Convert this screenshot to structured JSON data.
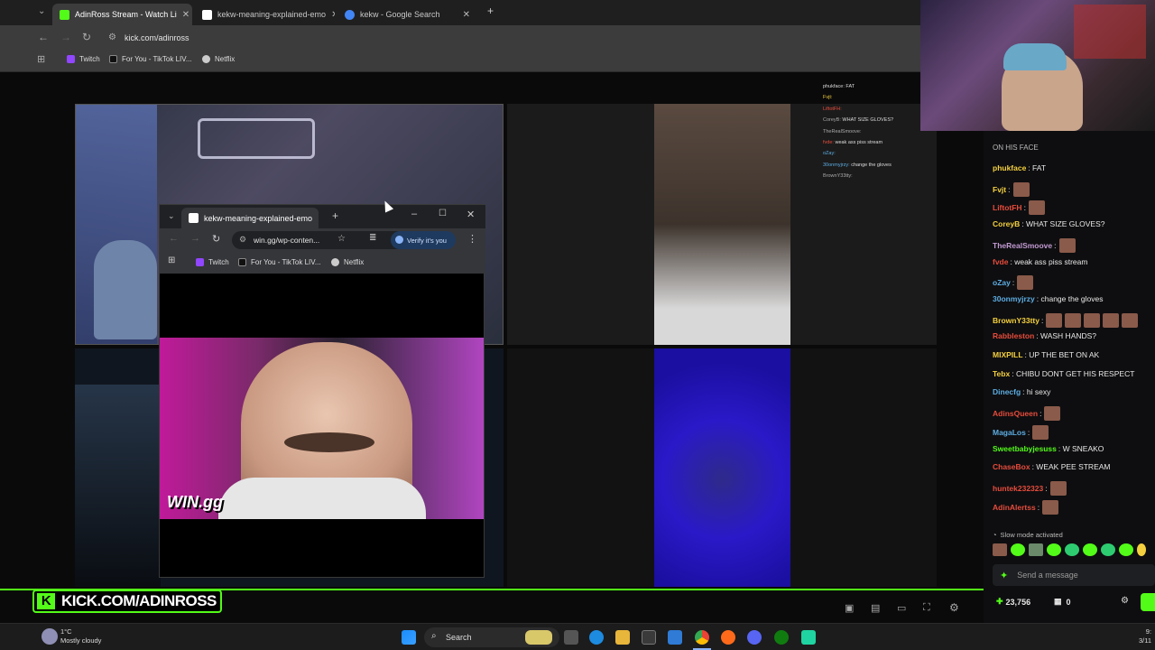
{
  "browser": {
    "tabs": [
      {
        "title": "AdinRoss Stream - Watch Li",
        "active": true,
        "favicon_color": "#53fc18"
      },
      {
        "title": "kekw-meaning-explained-emo",
        "active": false,
        "favicon_color": "#ffffff"
      },
      {
        "title": "kekw - Google Search",
        "active": false,
        "favicon_color": "#4285f4"
      }
    ],
    "new_tab": "+",
    "url": "kick.com/adinross",
    "bookmarks": [
      "Twitch",
      "For You - TikTok LIV...",
      "Netflix"
    ]
  },
  "popup": {
    "tab_title": "kekw-meaning-explained-emo",
    "url": "win.gg/wp-conten...",
    "verify_label": "Verify it's you",
    "bookmarks": [
      "Twitch",
      "For You - TikTok LIV...",
      "Netflix"
    ],
    "watermark": "WIN.gg"
  },
  "overlay_chat": [
    {
      "user": "phukface:",
      "text": "FAT"
    },
    {
      "user": "Fvjt:",
      "text": ""
    },
    {
      "user": "LiftotFH:",
      "text": ""
    },
    {
      "user": "CoreyB:",
      "text": "WHAT SIZE GLOVES?"
    },
    {
      "user": "TheRealSmoove:",
      "text": ""
    },
    {
      "user": "fvde:",
      "text": "weak ass piss stream"
    },
    {
      "user": "oZay:",
      "text": ""
    },
    {
      "user": "30onmyjrzy:",
      "text": "change the gloves"
    },
    {
      "user": "BrownY33tty:",
      "text": ""
    }
  ],
  "chat": {
    "partial_top": "ON HIS FACE",
    "messages": [
      {
        "user": "phukface",
        "color": "#f4d03f",
        "text": ": FAT",
        "emotes": 0
      },
      {
        "user": "Fvjt",
        "color": "#f4d03f",
        "text": ":",
        "emotes": 1
      },
      {
        "user": "LiftotFH",
        "color": "#e74c3c",
        "text": ":",
        "emotes": 1
      },
      {
        "user": "CoreyB",
        "color": "#f4d03f",
        "text": ": WHAT SIZE GLOVES?",
        "emotes": 0
      },
      {
        "user": "TheRealSmoove",
        "color": "#c39bd3",
        "text": ":",
        "emotes": 1
      },
      {
        "user": "fvde",
        "color": "#e74c3c",
        "text": ": weak ass piss stream",
        "emotes": 0
      },
      {
        "user": "oZay",
        "color": "#5dade2",
        "text": ":",
        "emotes": 1
      },
      {
        "user": "30onmyjrzy",
        "color": "#5dade2",
        "text": ": change the gloves",
        "emotes": 0
      },
      {
        "user": "BrownY33tty",
        "color": "#f4d03f",
        "text": ":",
        "emotes": 5
      },
      {
        "user": "Rabbleston",
        "color": "#e74c3c",
        "text": ": WASH HANDS?",
        "emotes": 0
      },
      {
        "user": "MIXPILL",
        "color": "#f4d03f",
        "text": ": UP THE BET ON AK",
        "emotes": 0
      },
      {
        "user": "Tebx",
        "color": "#f4d03f",
        "text": ": CHIBU DONT GET HIS RESPECT",
        "emotes": 0
      },
      {
        "user": "Dinecfg",
        "color": "#5dade2",
        "text": ": hi sexy",
        "emotes": 0
      },
      {
        "user": "AdinsQueen",
        "color": "#e74c3c",
        "text": ":",
        "emotes": 1
      },
      {
        "user": "MagaLos",
        "color": "#5dade2",
        "text": ":",
        "emotes": 1
      },
      {
        "user": "Sweetbabyjesuss",
        "color": "#53fc18",
        "text": ": W SNEAKO",
        "emotes": 0
      },
      {
        "user": "ChaseBox",
        "color": "#e74c3c",
        "text": ": WEAK PEE STREAM",
        "emotes": 0
      },
      {
        "user": "huntek232323",
        "color": "#e74c3c",
        "text": ":",
        "emotes": 1
      },
      {
        "user": "AdinAlertss",
        "color": "#e74c3c",
        "text": ":",
        "emotes": 1
      }
    ],
    "slow_mode": "Slow mode activated",
    "send_placeholder": "Send a message",
    "points": "23,756",
    "gifts": "0"
  },
  "stream_banner": "KICK.COM/ADINROSS",
  "taskbar": {
    "weather_temp": "1°C",
    "weather_desc": "Mostly cloudy",
    "search": "Search",
    "time": "9:",
    "date": "3/11"
  }
}
